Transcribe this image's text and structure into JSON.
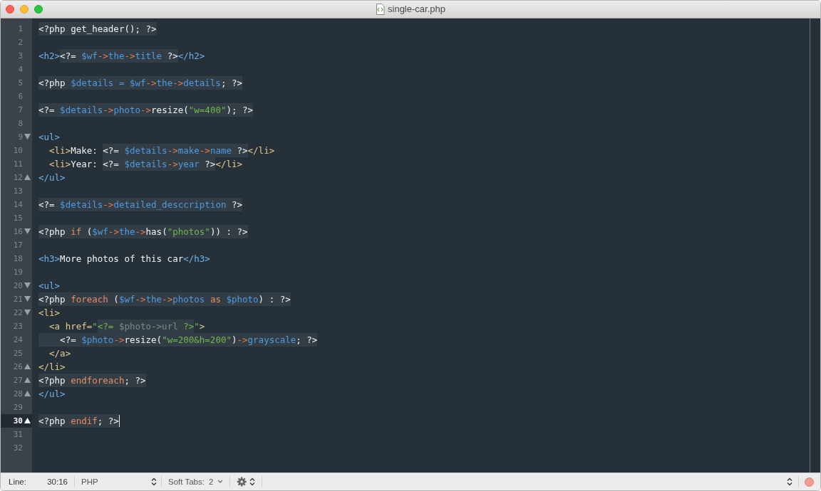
{
  "window": {
    "title": "single-car.php"
  },
  "lines": [
    {
      "number": "1",
      "kind": "line",
      "current": false,
      "segments": [
        {
          "php": true,
          "tokens": [
            {
              "kind": "plain",
              "text": "<?php get_header(); ?>"
            }
          ]
        }
      ]
    },
    {
      "number": "2",
      "kind": "line",
      "current": false
    },
    {
      "number": "3",
      "kind": "line",
      "current": false,
      "segments": [
        {
          "php": false,
          "tokens": [
            {
              "kind": "tag",
              "text": "<h2>"
            }
          ]
        },
        {
          "php": true,
          "tokens": [
            {
              "kind": "plain",
              "text": "<?= "
            },
            {
              "kind": "var",
              "text": "$wf"
            },
            {
              "kind": "arrow",
              "text": "->"
            },
            {
              "kind": "prop",
              "text": "the"
            },
            {
              "kind": "arrow",
              "text": "->"
            },
            {
              "kind": "prop",
              "text": "title"
            },
            {
              "kind": "plain",
              "text": " ?>"
            }
          ]
        },
        {
          "php": false,
          "tokens": [
            {
              "kind": "tag",
              "text": "</h2>"
            }
          ]
        }
      ]
    },
    {
      "number": "4",
      "kind": "line",
      "current": false
    },
    {
      "number": "5",
      "kind": "line",
      "current": false,
      "segments": [
        {
          "php": true,
          "tokens": [
            {
              "kind": "plain",
              "text": "<?php "
            },
            {
              "kind": "var",
              "text": "$details = $wf"
            },
            {
              "kind": "arrow",
              "text": "->"
            },
            {
              "kind": "prop",
              "text": "the"
            },
            {
              "kind": "arrow",
              "text": "->"
            },
            {
              "kind": "prop",
              "text": "details"
            },
            {
              "kind": "plain",
              "text": "; ?>"
            }
          ]
        }
      ]
    },
    {
      "number": "6",
      "kind": "line",
      "current": false
    },
    {
      "number": "7",
      "kind": "line",
      "current": false,
      "segments": [
        {
          "php": true,
          "tokens": [
            {
              "kind": "plain",
              "text": "<?= "
            },
            {
              "kind": "var",
              "text": "$details"
            },
            {
              "kind": "arrow",
              "text": "->"
            },
            {
              "kind": "prop",
              "text": "photo"
            },
            {
              "kind": "arrow",
              "text": "->"
            },
            {
              "kind": "plain",
              "text": "resize("
            },
            {
              "kind": "string",
              "text": "\"w=400\""
            },
            {
              "kind": "plain",
              "text": "); ?>"
            }
          ]
        }
      ]
    },
    {
      "number": "8",
      "kind": "line",
      "current": false
    },
    {
      "number": "9",
      "kind": "opener",
      "current": false,
      "segments": [
        {
          "php": false,
          "tokens": [
            {
              "kind": "tag",
              "text": "<ul>"
            }
          ]
        }
      ]
    },
    {
      "number": "10",
      "kind": "line",
      "current": false,
      "segments": [
        {
          "php": false,
          "tokens": [
            {
              "kind": "tag2",
              "text": "  <li>"
            },
            {
              "kind": "plain",
              "text": "Make: "
            }
          ]
        },
        {
          "php": true,
          "tokens": [
            {
              "kind": "plain",
              "text": "<?= "
            },
            {
              "kind": "var",
              "text": "$details"
            },
            {
              "kind": "arrow",
              "text": "->"
            },
            {
              "kind": "prop",
              "text": "make"
            },
            {
              "kind": "arrow",
              "text": "->"
            },
            {
              "kind": "prop",
              "text": "name"
            },
            {
              "kind": "plain",
              "text": " ?>"
            }
          ]
        },
        {
          "php": false,
          "tokens": [
            {
              "kind": "tag2",
              "text": "</li>"
            }
          ]
        }
      ]
    },
    {
      "number": "11",
      "kind": "line",
      "current": false,
      "segments": [
        {
          "php": false,
          "tokens": [
            {
              "kind": "tag2",
              "text": "  <li>"
            },
            {
              "kind": "plain",
              "text": "Year: "
            }
          ]
        },
        {
          "php": true,
          "tokens": [
            {
              "kind": "plain",
              "text": "<?= "
            },
            {
              "kind": "var",
              "text": "$details"
            },
            {
              "kind": "arrow",
              "text": "->"
            },
            {
              "kind": "prop",
              "text": "year"
            },
            {
              "kind": "plain",
              "text": " ?>"
            }
          ]
        },
        {
          "php": false,
          "tokens": [
            {
              "kind": "tag2",
              "text": "</li>"
            }
          ]
        }
      ]
    },
    {
      "number": "12",
      "kind": "closer",
      "current": false,
      "segments": [
        {
          "php": false,
          "tokens": [
            {
              "kind": "tag",
              "text": "</ul>"
            }
          ]
        }
      ]
    },
    {
      "number": "13",
      "kind": "line",
      "current": false
    },
    {
      "number": "14",
      "kind": "line",
      "current": false,
      "segments": [
        {
          "php": true,
          "tokens": [
            {
              "kind": "plain",
              "text": "<?= "
            },
            {
              "kind": "var",
              "text": "$details"
            },
            {
              "kind": "arrow",
              "text": "->"
            },
            {
              "kind": "prop",
              "text": "detailed_desccription"
            },
            {
              "kind": "plain",
              "text": " ?>"
            }
          ]
        }
      ]
    },
    {
      "number": "15",
      "kind": "line",
      "current": false
    },
    {
      "number": "16",
      "kind": "opener",
      "current": false,
      "segments": [
        {
          "php": true,
          "tokens": [
            {
              "kind": "plain",
              "text": "<?php "
            },
            {
              "kind": "keyword",
              "text": "if"
            },
            {
              "kind": "plain",
              "text": " ("
            },
            {
              "kind": "var",
              "text": "$wf"
            },
            {
              "kind": "arrow",
              "text": "->"
            },
            {
              "kind": "prop",
              "text": "the"
            },
            {
              "kind": "arrow",
              "text": "->"
            },
            {
              "kind": "plain",
              "text": "has("
            },
            {
              "kind": "string",
              "text": "\"photos\""
            },
            {
              "kind": "plain",
              "text": ")) : ?>"
            }
          ]
        }
      ]
    },
    {
      "number": "17",
      "kind": "line",
      "current": false
    },
    {
      "number": "18",
      "kind": "line",
      "current": false,
      "segments": [
        {
          "php": false,
          "tokens": [
            {
              "kind": "tag",
              "text": "<h3>"
            },
            {
              "kind": "plain",
              "text": "More photos of this car"
            },
            {
              "kind": "tag",
              "text": "</h3>"
            }
          ]
        }
      ]
    },
    {
      "number": "19",
      "kind": "line",
      "current": false
    },
    {
      "number": "20",
      "kind": "opener",
      "current": false,
      "segments": [
        {
          "php": false,
          "tokens": [
            {
              "kind": "tag",
              "text": "<ul>"
            }
          ]
        }
      ]
    },
    {
      "number": "21",
      "kind": "opener",
      "current": false,
      "segments": [
        {
          "php": true,
          "tokens": [
            {
              "kind": "plain",
              "text": "<?php "
            },
            {
              "kind": "keyword",
              "text": "foreach"
            },
            {
              "kind": "plain",
              "text": " ("
            },
            {
              "kind": "var",
              "text": "$wf"
            },
            {
              "kind": "arrow",
              "text": "->"
            },
            {
              "kind": "prop",
              "text": "the"
            },
            {
              "kind": "arrow",
              "text": "->"
            },
            {
              "kind": "prop",
              "text": "photos "
            },
            {
              "kind": "keyword",
              "text": "as "
            },
            {
              "kind": "var",
              "text": "$photo"
            },
            {
              "kind": "plain",
              "text": ") : ?>"
            }
          ]
        }
      ]
    },
    {
      "number": "22",
      "kind": "opener",
      "current": false,
      "segments": [
        {
          "php": false,
          "tokens": [
            {
              "kind": "tag2",
              "text": "<li>"
            }
          ]
        }
      ]
    },
    {
      "number": "23",
      "kind": "line",
      "current": false,
      "segments": [
        {
          "php": false,
          "tokens": [
            {
              "kind": "tag2",
              "text": "  <a href="
            },
            {
              "kind": "string",
              "text": "\""
            }
          ]
        },
        {
          "php": true,
          "tokens": [
            {
              "kind": "string",
              "text": "<?="
            },
            {
              "kind": "dim",
              "text": " $photo->url "
            },
            {
              "kind": "string",
              "text": "?>"
            }
          ]
        },
        {
          "php": false,
          "tokens": [
            {
              "kind": "string",
              "text": "\""
            },
            {
              "kind": "tag2",
              "text": ">"
            }
          ]
        }
      ]
    },
    {
      "number": "24",
      "kind": "line",
      "current": false,
      "segments": [
        {
          "php": true,
          "tokens": [
            {
              "kind": "plain",
              "text": "    <?= "
            },
            {
              "kind": "var",
              "text": "$photo"
            },
            {
              "kind": "arrow",
              "text": "->"
            },
            {
              "kind": "plain",
              "text": "resize("
            },
            {
              "kind": "string",
              "text": "\"w=200&h=200\""
            },
            {
              "kind": "plain",
              "text": ")"
            },
            {
              "kind": "arrow",
              "text": "->"
            },
            {
              "kind": "prop",
              "text": "grayscale"
            },
            {
              "kind": "plain",
              "text": "; ?>"
            }
          ]
        }
      ]
    },
    {
      "number": "25",
      "kind": "line",
      "current": false,
      "segments": [
        {
          "php": false,
          "tokens": [
            {
              "kind": "tag2",
              "text": "  </a>"
            }
          ]
        }
      ]
    },
    {
      "number": "26",
      "kind": "closer",
      "current": false,
      "segments": [
        {
          "php": false,
          "tokens": [
            {
              "kind": "tag2",
              "text": "</li>"
            }
          ]
        }
      ]
    },
    {
      "number": "27",
      "kind": "closer",
      "current": false,
      "segments": [
        {
          "php": true,
          "tokens": [
            {
              "kind": "plain",
              "text": "<?php "
            },
            {
              "kind": "keyword",
              "text": "endforeach"
            },
            {
              "kind": "plain",
              "text": "; ?>"
            }
          ]
        }
      ]
    },
    {
      "number": "28",
      "kind": "closer",
      "current": false,
      "segments": [
        {
          "php": false,
          "tokens": [
            {
              "kind": "tag",
              "text": "</ul>"
            }
          ]
        }
      ]
    },
    {
      "number": "29",
      "kind": "line",
      "current": false
    },
    {
      "number": "30",
      "kind": "closer",
      "current": true,
      "segments": [
        {
          "php": true,
          "tokens": [
            {
              "kind": "plain",
              "text": "<?php "
            },
            {
              "kind": "keyword",
              "text": "endif"
            },
            {
              "kind": "plain",
              "text": "; ?>"
            }
          ]
        }
      ]
    },
    {
      "number": "31",
      "kind": "line",
      "current": false
    },
    {
      "number": "32",
      "kind": "line",
      "current": false
    }
  ],
  "status_bar": {
    "line_label": "Line:",
    "position": "30:16",
    "syntax": "PHP",
    "tabs_label": "Soft Tabs:",
    "tab_size": "2"
  }
}
